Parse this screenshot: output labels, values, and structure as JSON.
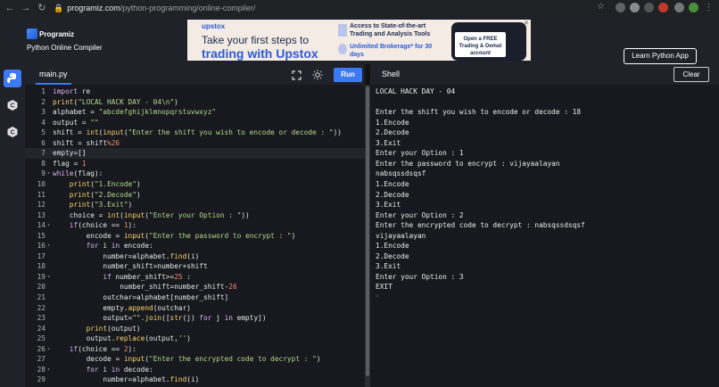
{
  "browser": {
    "url_host": "programiz.com",
    "url_path": "/python-programming/online-compiler/"
  },
  "site": {
    "logo_text": "Programiz",
    "subtitle": "Python Online Compiler",
    "learn_button": "Learn Python App"
  },
  "ad": {
    "brand": "upstox",
    "line1": "Take your first steps to",
    "line2": "trading with Upstox",
    "right1": "Access to State-of-the-art Trading and Analysis Tools",
    "right2": "Unlimited Brokerage* for 30 days",
    "cta": "Open a FREE Trading & Demat account"
  },
  "editor": {
    "file_name": "main.py",
    "run_label": "Run",
    "highlighted_line": 7,
    "lines": [
      {
        "n": "1",
        "fold": "",
        "indent": 0,
        "html": "<span class='kw'>import</span> re"
      },
      {
        "n": "2",
        "fold": "",
        "indent": 0,
        "html": "<span class='fn'>print</span>(<span class='str'>\"LOCAL HACK DAY - 04\\n\"</span>)"
      },
      {
        "n": "3",
        "fold": "",
        "indent": 0,
        "html": "alphabet = <span class='str'>\"abcdefghijklmnopqrstuvwxyz\"</span>"
      },
      {
        "n": "4",
        "fold": "",
        "indent": 0,
        "html": "output = <span class='str'>\"\"</span>"
      },
      {
        "n": "5",
        "fold": "",
        "indent": 0,
        "html": "shift = <span class='fn'>int</span>(<span class='fn'>input</span>(<span class='str'>\"Enter the shift you wish to encode or decode : \"</span>))"
      },
      {
        "n": "6",
        "fold": "",
        "indent": 0,
        "html": "shift = shift<span class='op'>%</span><span class='num'>26</span>"
      },
      {
        "n": "7",
        "fold": "",
        "indent": 0,
        "html": "empty=[]"
      },
      {
        "n": "8",
        "fold": "",
        "indent": 0,
        "html": "flag = <span class='num'>1</span>"
      },
      {
        "n": "9",
        "fold": "▾",
        "indent": 0,
        "html": "<span class='kw'>while</span>(flag):"
      },
      {
        "n": "10",
        "fold": "",
        "indent": 1,
        "html": "<span class='fn'>print</span>(<span class='str'>\"1.Encode\"</span>)"
      },
      {
        "n": "11",
        "fold": "",
        "indent": 1,
        "html": "<span class='fn'>print</span>(<span class='str'>\"2.Decode\"</span>)"
      },
      {
        "n": "12",
        "fold": "",
        "indent": 1,
        "html": "<span class='fn'>print</span>(<span class='str'>\"3.Exit\"</span>)"
      },
      {
        "n": "13",
        "fold": "",
        "indent": 1,
        "html": "choice = <span class='fn'>int</span>(<span class='fn'>input</span>(<span class='str'>\"Enter your Option : \"</span>))"
      },
      {
        "n": "14",
        "fold": "▾",
        "indent": 1,
        "html": "<span class='kw'>if</span>(choice == <span class='num'>1</span>):"
      },
      {
        "n": "15",
        "fold": "",
        "indent": 2,
        "html": "encode = <span class='fn'>input</span>(<span class='str'>\"Enter the password to encrypt : \"</span>)"
      },
      {
        "n": "16",
        "fold": "▾",
        "indent": 2,
        "html": "<span class='kw'>for</span> i <span class='kw'>in</span> encode:"
      },
      {
        "n": "17",
        "fold": "",
        "indent": 3,
        "html": "number=alphabet.<span class='fn'>find</span>(i)"
      },
      {
        "n": "18",
        "fold": "",
        "indent": 3,
        "html": "number_shift=number+shift"
      },
      {
        "n": "19",
        "fold": "▾",
        "indent": 3,
        "html": "<span class='kw'>if</span> number_shift&gt;=<span class='num'>25</span> :"
      },
      {
        "n": "20",
        "fold": "",
        "indent": 4,
        "html": "number_shift=number_shift-<span class='num'>26</span>"
      },
      {
        "n": "21",
        "fold": "",
        "indent": 3,
        "html": "outchar=alphabet[number_shift]"
      },
      {
        "n": "22",
        "fold": "",
        "indent": 3,
        "html": "empty.<span class='fn'>append</span>(outchar)"
      },
      {
        "n": "23",
        "fold": "",
        "indent": 3,
        "html": "output=<span class='str'>\"\"</span>.<span class='fn'>join</span>([<span class='fn'>str</span>(j) <span class='kw'>for</span> j <span class='kw'>in</span> empty])"
      },
      {
        "n": "24",
        "fold": "",
        "indent": 2,
        "html": "<span class='fn'>print</span>(output)"
      },
      {
        "n": "25",
        "fold": "",
        "indent": 2,
        "html": "output.<span class='fn'>replace</span>(output,<span class='str'>''</span>)"
      },
      {
        "n": "26",
        "fold": "▾",
        "indent": 1,
        "html": "<span class='kw'>if</span>(choice == <span class='num'>2</span>):"
      },
      {
        "n": "27",
        "fold": "",
        "indent": 2,
        "html": "decode = <span class='fn'>input</span>(<span class='str'>\"Enter the encrypted code to decrypt : \"</span>)"
      },
      {
        "n": "28",
        "fold": "▾",
        "indent": 2,
        "html": "<span class='kw'>for</span> i <span class='kw'>in</span> decode:"
      },
      {
        "n": "29",
        "fold": "",
        "indent": 3,
        "html": "number=alphabet.<span class='fn'>find</span>(i)"
      }
    ]
  },
  "shell": {
    "title": "Shell",
    "clear_label": "Clear",
    "lines": [
      "LOCAL HACK DAY - 04",
      "",
      "Enter the shift you wish to encode or decode : 18",
      "1.Encode",
      "2.Decode",
      "3.Exit",
      "Enter your Option : 1",
      "Enter the password to encrypt : vijayaalayan",
      "nabsqssdsqsf",
      "1.Encode",
      "2.Decode",
      "3.Exit",
      "Enter your Option : 2",
      "Enter the encrypted code to decrypt : nabsqssdsqsf",
      "vijayaalayan",
      "1.Encode",
      "2.Decode",
      "3.Exit",
      "Enter your Option : 3",
      "EXIT"
    ],
    "prompt": ">"
  },
  "colors": {
    "accent": "#3d79f2",
    "editor_bg": "#17191e",
    "header_bg": "#1f2229"
  }
}
